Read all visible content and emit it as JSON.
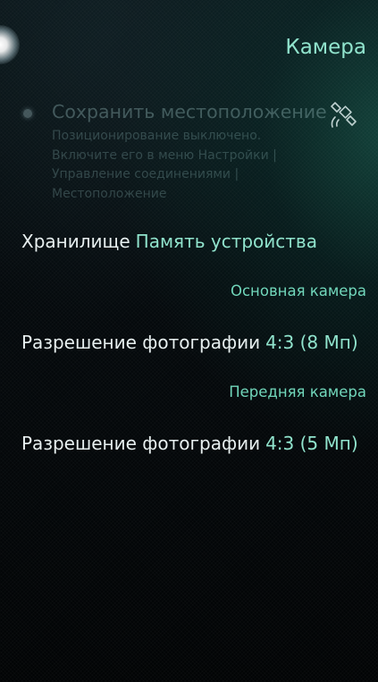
{
  "page": {
    "title": "Камера"
  },
  "location": {
    "label": "Сохранить местоположение",
    "description": "Позиционирование выключено. Включите его в меню Настройки | Управление соединениями | Местоположение",
    "enabled": false,
    "icon": "satellite-icon"
  },
  "storage": {
    "label": "Хранилище",
    "value": "Память устройства"
  },
  "main_camera": {
    "header": "Основная камера",
    "resolution_label": "Разрешение фотографии",
    "resolution_value": "4:3 (8 Мп)"
  },
  "front_camera": {
    "header": "Передняя камера",
    "resolution_label": "Разрешение фотографии",
    "resolution_value": "4:3 (5 Мп)"
  },
  "colors": {
    "accent": "#8fe3cc",
    "primary_text": "#e8f0f0",
    "disabled_text": "#5f7d7d"
  }
}
